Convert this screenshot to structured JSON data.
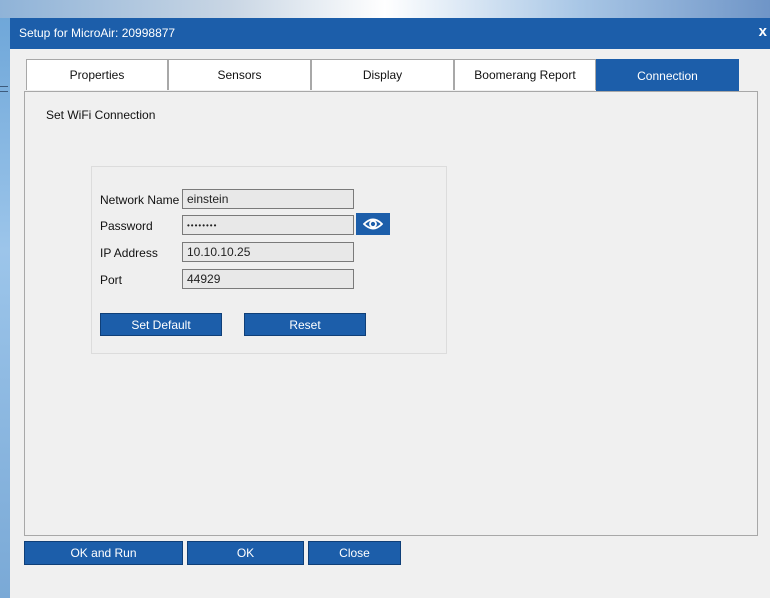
{
  "window": {
    "title": "Setup for MicroAir: 20998877",
    "close_label": "x"
  },
  "tabs": [
    {
      "label": "Properties"
    },
    {
      "label": "Sensors"
    },
    {
      "label": "Display"
    },
    {
      "label": "Boomerang Report"
    },
    {
      "label": "Connection"
    }
  ],
  "active_tab": "Connection",
  "connection": {
    "section_title": "Set WiFi Connection",
    "network_name_label": "Network Name",
    "network_name_value": "einstein",
    "password_label": "Password",
    "password_value": "••••••••",
    "ip_label": "IP Address",
    "ip_value": "10.10.10.25",
    "port_label": "Port",
    "port_value": "44929",
    "set_default_label": "Set Default",
    "reset_label": "Reset"
  },
  "footer": {
    "ok_and_run_label": "OK and Run",
    "ok_label": "OK",
    "close_label": "Close"
  },
  "colors": {
    "accent": "#1c5eaa",
    "background": "#f0f0f0"
  }
}
